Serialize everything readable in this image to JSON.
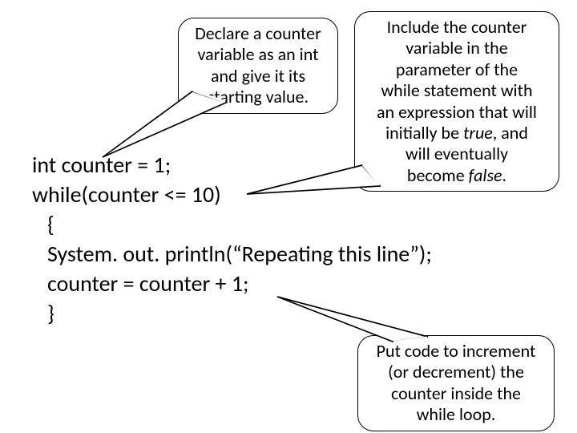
{
  "callouts": {
    "declare": "Declare a counter\nvariable as an int\nand give it its\nstarting value.",
    "include_pre": "Include the counter\nvariable in the\nparameter of the\nwhile statement with\nan expression that will\ninitially be ",
    "include_true": "true",
    "include_mid": ", and\nwill eventually\nbecome ",
    "include_false": "false",
    "include_post": ".",
    "increment": "Put code to increment\n(or decrement) the\ncounter inside the\nwhile loop."
  },
  "code": {
    "l1": "int counter = 1;",
    "l2": "while(counter <= 10)",
    "l3": "   {",
    "l4": "   System. out. println(“Repeating this line”);",
    "l5": "   counter = counter + 1;",
    "l6": "   }"
  }
}
